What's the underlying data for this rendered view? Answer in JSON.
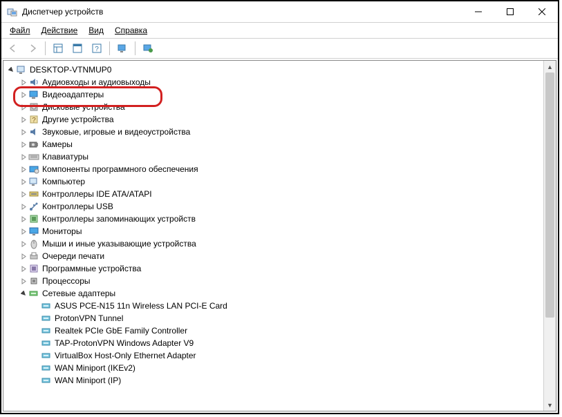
{
  "window": {
    "title": "Диспетчер устройств"
  },
  "menu": {
    "file": "Файл",
    "action": "Действие",
    "view": "Вид",
    "help": "Справка"
  },
  "tree": {
    "root": "DESKTOP-VTNMUP0",
    "categories": [
      {
        "label": "Аудиовходы и аудиовыходы",
        "icon": "audio"
      },
      {
        "label": "Видеоадаптеры",
        "icon": "display",
        "highlighted": true
      },
      {
        "label": "Дисковые устройства",
        "icon": "disk"
      },
      {
        "label": "Другие устройства",
        "icon": "other"
      },
      {
        "label": "Звуковые, игровые и видеоустройства",
        "icon": "sound"
      },
      {
        "label": "Камеры",
        "icon": "camera"
      },
      {
        "label": "Клавиатуры",
        "icon": "keyboard"
      },
      {
        "label": "Компоненты программного обеспечения",
        "icon": "software"
      },
      {
        "label": "Компьютер",
        "icon": "computer"
      },
      {
        "label": "Контроллеры IDE ATA/ATAPI",
        "icon": "ide"
      },
      {
        "label": "Контроллеры USB",
        "icon": "usb"
      },
      {
        "label": "Контроллеры запоминающих устройств",
        "icon": "storage"
      },
      {
        "label": "Мониторы",
        "icon": "monitor"
      },
      {
        "label": "Мыши и иные указывающие устройства",
        "icon": "mouse"
      },
      {
        "label": "Очереди печати",
        "icon": "printer"
      },
      {
        "label": "Программные устройства",
        "icon": "swdev"
      },
      {
        "label": "Процессоры",
        "icon": "cpu"
      },
      {
        "label": "Сетевые адаптеры",
        "icon": "network",
        "expanded": true,
        "children": [
          "ASUS PCE-N15 11n Wireless LAN PCI-E Card",
          "ProtonVPN Tunnel",
          "Realtek PCIe GbE Family Controller",
          "TAP-ProtonVPN Windows Adapter V9",
          "VirtualBox Host-Only Ethernet Adapter",
          "WAN Miniport (IKEv2)",
          "WAN Miniport (IP)"
        ]
      }
    ]
  }
}
